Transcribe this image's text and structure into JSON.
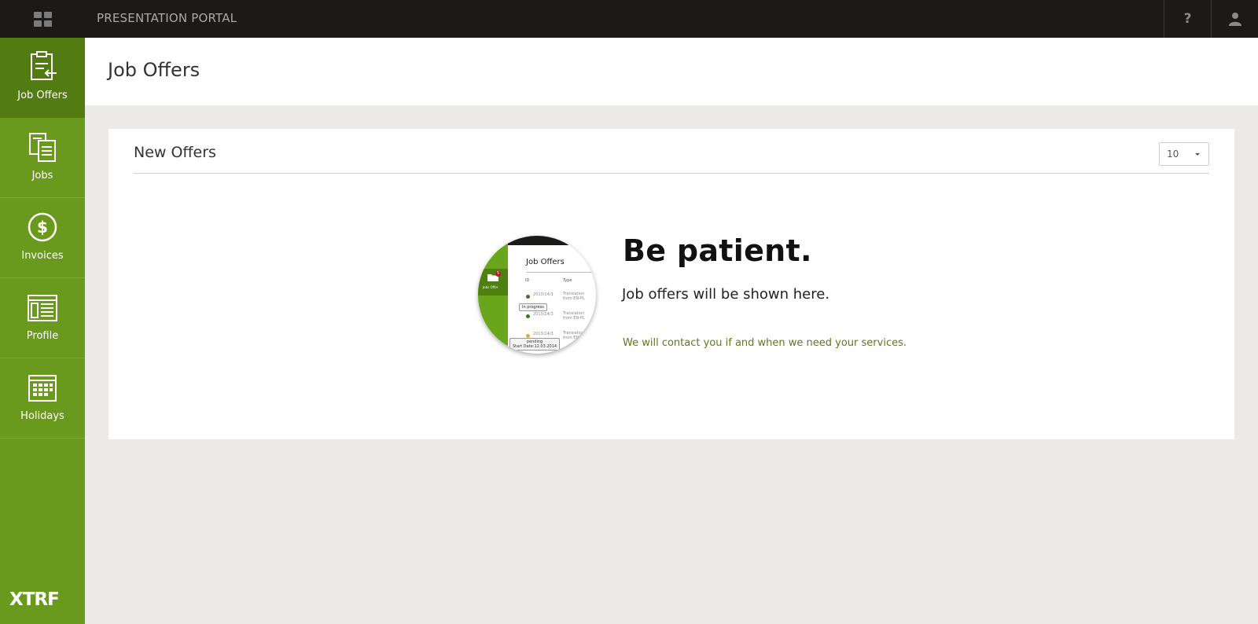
{
  "topbar": {
    "portal_title": "PRESENTATION PORTAL",
    "help_label": "?",
    "icons": [
      "apps-grid-icon",
      "help-icon",
      "user-icon"
    ]
  },
  "sidebar": {
    "items": [
      {
        "label": "Job Offers",
        "icon": "clipboard-arrow-icon",
        "active": true
      },
      {
        "label": "Jobs",
        "icon": "documents-icon",
        "active": false
      },
      {
        "label": "Invoices",
        "icon": "dollar-circle-icon",
        "active": false
      },
      {
        "label": "Profile",
        "icon": "profile-card-icon",
        "active": false
      },
      {
        "label": "Holidays",
        "icon": "calendar-icon",
        "active": false
      }
    ],
    "brand": "XTRF"
  },
  "header": {
    "title": "Job Offers"
  },
  "panel": {
    "title": "New Offers",
    "page_size": "10",
    "empty_state": {
      "headline": "Be patient.",
      "subline": "Job offers will be shown here.",
      "note": "We will contact you if and when we need your services.",
      "illustration": {
        "title": "Job Offers",
        "col_id": "ID",
        "col_type": "Type",
        "sidebar_label": "Jobs Offer",
        "badge": "5",
        "rows": [
          {
            "id": "2013/14/3",
            "type": "Translation from EN-PL",
            "status_color": "#2f7d1c"
          },
          {
            "id": "2013/14/3",
            "type": "Translation from EN-PL",
            "status_color": "#2f7d1c"
          },
          {
            "id": "2013/14/3",
            "type": "Translation from EN-PL",
            "status_color": "#e4b21a"
          }
        ],
        "tooltip_1": "In progress",
        "tooltip_2_line1": "pending",
        "tooltip_2_line2": "Start Date:12.03.2014"
      }
    }
  },
  "colors": {
    "sidebar": "#6a9a1d",
    "sidebar_active": "#527b12",
    "topbar": "#1b1a19",
    "note_text": "#5c7a1c"
  }
}
